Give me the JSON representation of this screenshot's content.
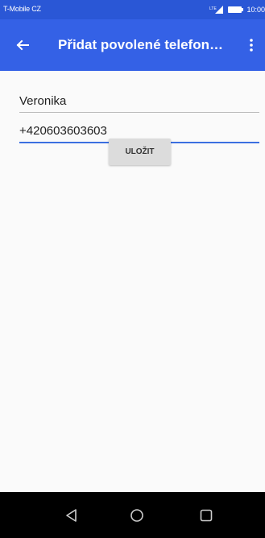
{
  "status_bar": {
    "carrier": "T-Mobile CZ",
    "time": "10:00",
    "icons": [
      "signal-icon",
      "battery-icon"
    ]
  },
  "app_bar": {
    "title": "Přidat povolené telefon…",
    "back_icon": "arrow-left-icon",
    "menu_icon": "more-vert-icon"
  },
  "form": {
    "name_value": "Veronika",
    "phone_value": "+420603603603",
    "save_label": "ULOŽIT"
  },
  "nav_bar": {
    "icons": [
      "back-triangle-icon",
      "home-circle-icon",
      "recents-square-icon"
    ]
  },
  "colors": {
    "status_bar": "#2a57d6",
    "app_bar": "#3461e6",
    "accent_underline": "#3b6fe0",
    "background": "#fafafa",
    "nav_bar": "#000000",
    "button": "#dcdcdc"
  }
}
